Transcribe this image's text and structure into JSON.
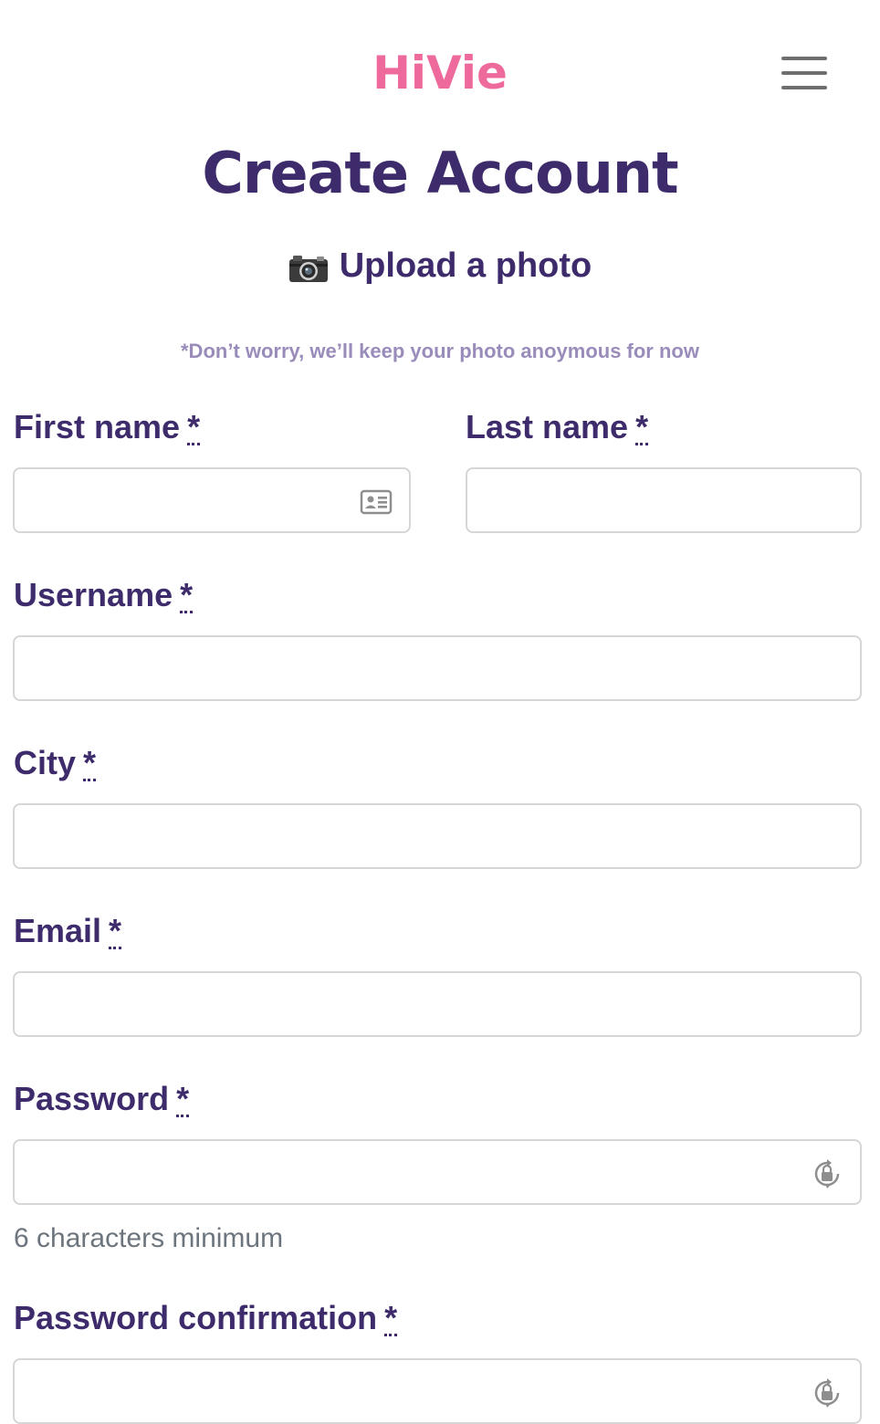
{
  "navbar": {
    "brand": "HiVie",
    "menu_icon": "hamburger-menu-icon"
  },
  "page": {
    "title": "Create Account"
  },
  "upload": {
    "icon": "camera-icon",
    "label": "Upload a photo",
    "notice": "*Don’t worry, we’ll keep your photo anoymous for now"
  },
  "form": {
    "required_mark": "*",
    "first_name": {
      "label": "First name",
      "value": "",
      "icon": "contact-card-icon"
    },
    "last_name": {
      "label": "Last name",
      "value": ""
    },
    "username": {
      "label": "Username",
      "value": ""
    },
    "city": {
      "label": "City",
      "value": ""
    },
    "email": {
      "label": "Email",
      "value": ""
    },
    "password": {
      "label": "Password",
      "value": "",
      "icon": "password-manager-lock-icon",
      "hint": "6 characters minimum"
    },
    "password_confirmation": {
      "label": "Password confirmation",
      "value": "",
      "icon": "password-manager-lock-icon"
    }
  },
  "colors": {
    "brand": "#ef6a9c",
    "primary_text": "#3d2b6b",
    "muted_text": "#9a8cba",
    "hint_text": "#6c757d",
    "border": "#d6d6d6"
  }
}
